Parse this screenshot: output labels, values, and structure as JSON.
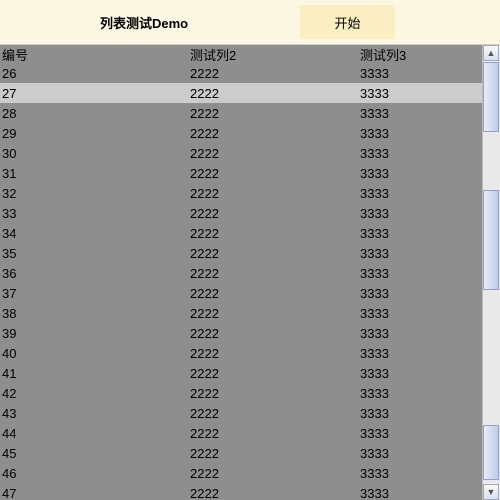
{
  "header": {
    "title": "列表测试Demo",
    "start_label": "开始"
  },
  "columns": {
    "col1": "编号",
    "col2": "测试列2",
    "col3": "测试列3"
  },
  "highlight_index": 1,
  "rows": [
    {
      "id": "26",
      "c2": "2222",
      "c3": "3333"
    },
    {
      "id": "27",
      "c2": "2222",
      "c3": "3333"
    },
    {
      "id": "28",
      "c2": "2222",
      "c3": "3333"
    },
    {
      "id": "29",
      "c2": "2222",
      "c3": "3333"
    },
    {
      "id": "30",
      "c2": "2222",
      "c3": "3333"
    },
    {
      "id": "31",
      "c2": "2222",
      "c3": "3333"
    },
    {
      "id": "32",
      "c2": "2222",
      "c3": "3333"
    },
    {
      "id": "33",
      "c2": "2222",
      "c3": "3333"
    },
    {
      "id": "34",
      "c2": "2222",
      "c3": "3333"
    },
    {
      "id": "35",
      "c2": "2222",
      "c3": "3333"
    },
    {
      "id": "36",
      "c2": "2222",
      "c3": "3333"
    },
    {
      "id": "37",
      "c2": "2222",
      "c3": "3333"
    },
    {
      "id": "38",
      "c2": "2222",
      "c3": "3333"
    },
    {
      "id": "39",
      "c2": "2222",
      "c3": "3333"
    },
    {
      "id": "40",
      "c2": "2222",
      "c3": "3333"
    },
    {
      "id": "41",
      "c2": "2222",
      "c3": "3333"
    },
    {
      "id": "42",
      "c2": "2222",
      "c3": "3333"
    },
    {
      "id": "43",
      "c2": "2222",
      "c3": "3333"
    },
    {
      "id": "44",
      "c2": "2222",
      "c3": "3333"
    },
    {
      "id": "45",
      "c2": "2222",
      "c3": "3333"
    },
    {
      "id": "46",
      "c2": "2222",
      "c3": "3333"
    },
    {
      "id": "47",
      "c2": "2222",
      "c3": "3333"
    }
  ]
}
